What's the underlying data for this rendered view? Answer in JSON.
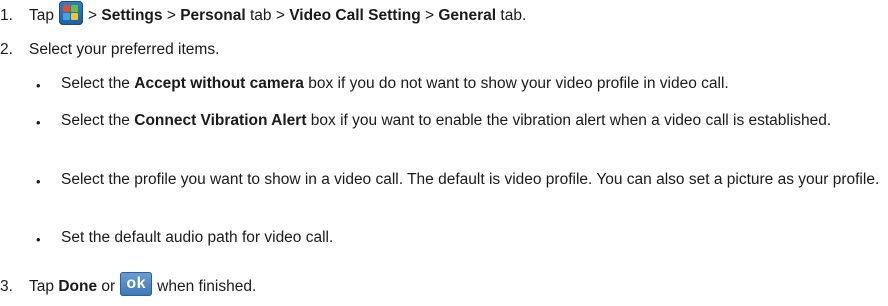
{
  "steps": [
    {
      "number": "1.",
      "parts": {
        "a": "Tap",
        "b": "> ",
        "c": "Settings",
        "d": " > ",
        "e": "Personal",
        "f": " tab > ",
        "g": "Video Call Setting",
        "h": " > ",
        "i": "General",
        "j": " tab."
      }
    },
    {
      "number": "2.",
      "text": "Select your preferred items."
    },
    {
      "number": "3.",
      "parts": {
        "a": "Tap ",
        "b": "Done",
        "c": " or",
        "d": "when finished."
      }
    }
  ],
  "bullets": [
    {
      "symbol": "•",
      "pre": "Select the ",
      "bold": "Accept without camera",
      "post": " box if you do not want to show your video profile in video call."
    },
    {
      "symbol": "•",
      "pre": "Select the ",
      "bold": "Connect Vibration Alert",
      "post": " box if you want to enable the vibration alert when a video call is established."
    },
    {
      "symbol": "•",
      "text": "Select the profile you want to show in a video call. The default is video profile. You can also set a picture as your profile."
    },
    {
      "symbol": "•",
      "text": "Set the default audio path for video call."
    }
  ],
  "icons": {
    "start_icon": "windows-start-icon",
    "ok_icon": "ok-button-icon",
    "ok_label": "ok"
  },
  "colors": {
    "start_blue": "#2e7fd1",
    "logo_red": "#e8482c",
    "logo_green": "#6cbf2f",
    "logo_blue": "#3aa6e8",
    "logo_yellow": "#f7c325",
    "ok_blue": "#4f8cc9"
  }
}
